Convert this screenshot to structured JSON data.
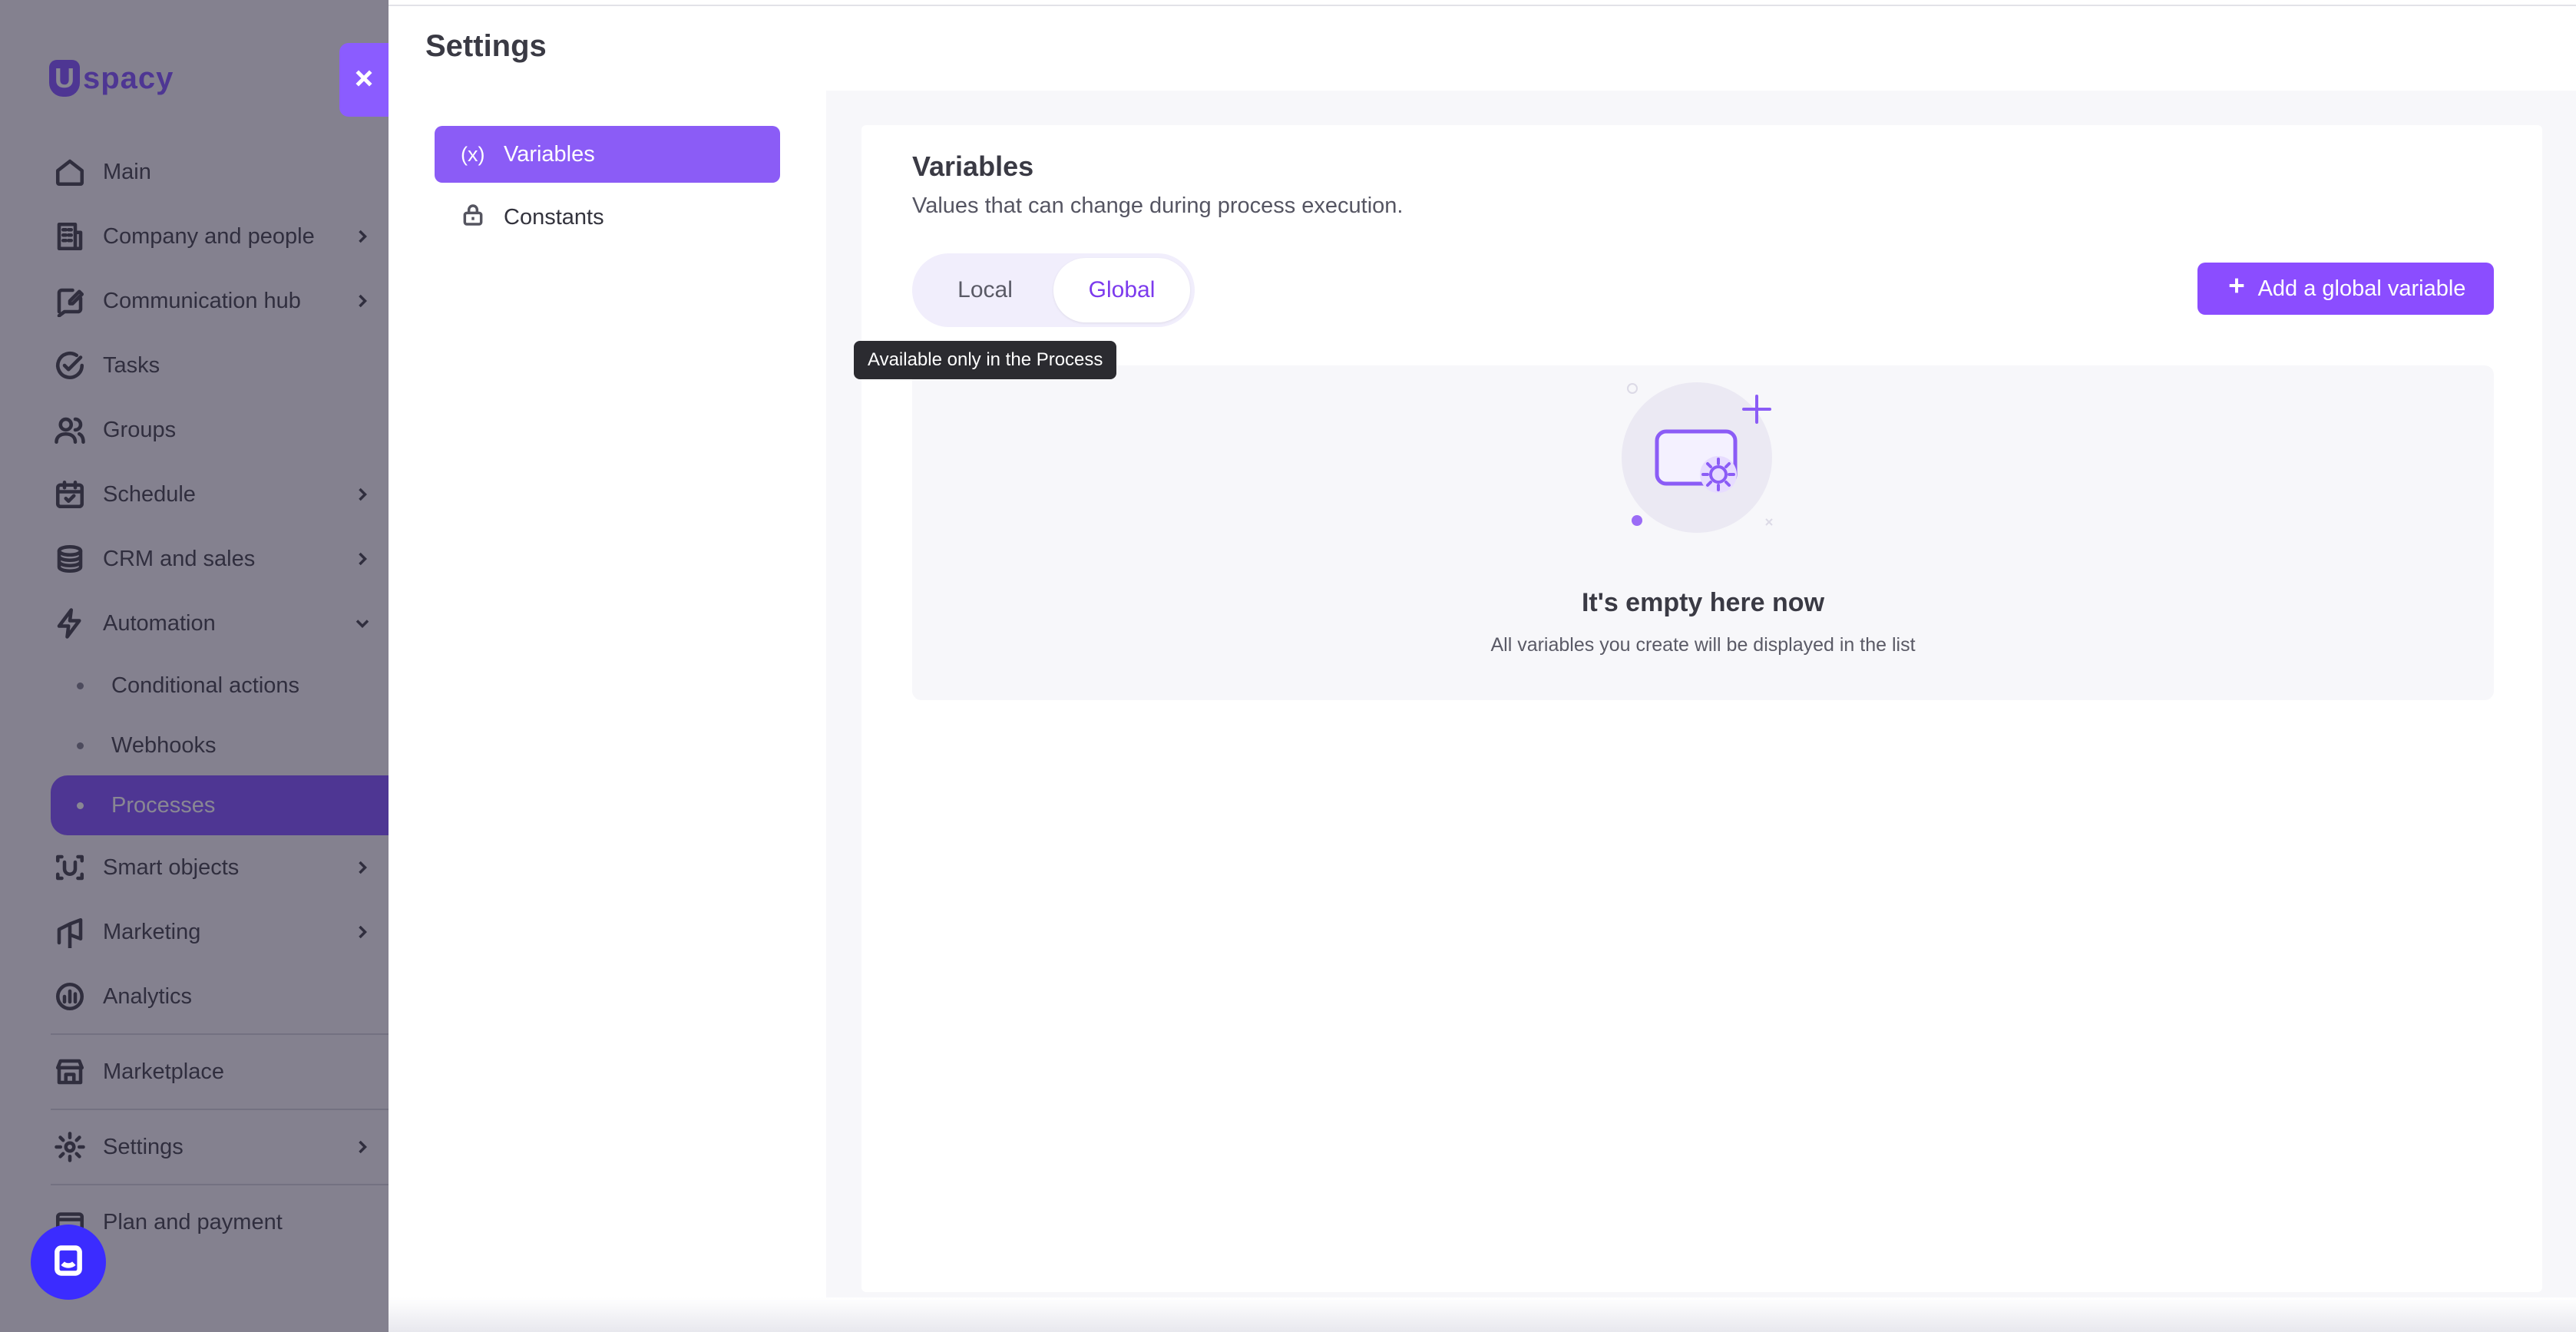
{
  "sidebar": {
    "logo_text": "spacy",
    "logo_letter": "U",
    "items": [
      {
        "label": "Main",
        "icon": "home-icon"
      },
      {
        "label": "Company and people",
        "icon": "building-icon"
      },
      {
        "label": "Communication hub",
        "icon": "chat-edit-icon"
      },
      {
        "label": "Tasks",
        "icon": "check-circle-icon"
      },
      {
        "label": "Groups",
        "icon": "users-icon"
      },
      {
        "label": "Schedule",
        "icon": "calendar-icon"
      },
      {
        "label": "CRM and sales",
        "icon": "coins-icon"
      },
      {
        "label": "Automation",
        "icon": "lightning-icon"
      },
      {
        "label": "Smart objects",
        "icon": "scan-icon"
      },
      {
        "label": "Marketing",
        "icon": "megaphone-icon"
      },
      {
        "label": "Analytics",
        "icon": "chart-icon"
      },
      {
        "label": "Marketplace",
        "icon": "store-icon"
      },
      {
        "label": "Settings",
        "icon": "gear-icon"
      },
      {
        "label": "Plan and payment",
        "icon": "card-icon"
      }
    ],
    "automation_sub": [
      {
        "label": "Conditional actions"
      },
      {
        "label": "Webhooks"
      },
      {
        "label": "Processes"
      }
    ]
  },
  "panel": {
    "title": "Settings",
    "nav": [
      {
        "label": "Variables",
        "icon_text": "(x)"
      },
      {
        "label": "Constants"
      }
    ]
  },
  "variables": {
    "title": "Variables",
    "subtitle": "Values that can change during process execution.",
    "toggle": {
      "local": "Local",
      "global": "Global",
      "selected": "Global"
    },
    "tooltip": "Available only in the Process",
    "add_button": "Add a global variable",
    "empty_title": "It's empty here now",
    "empty_subtitle": "All variables you create will be displayed in the list"
  },
  "colors": {
    "accent": "#8b5cf6",
    "brand": "#7c4dff"
  }
}
